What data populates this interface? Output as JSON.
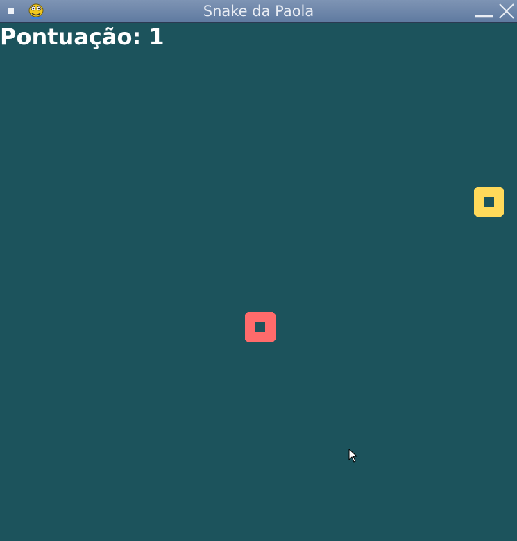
{
  "window": {
    "title": "Snake da Paola",
    "icons": {
      "menu": "window-menu-icon",
      "app": "pygame-snake-icon",
      "minimize": "minimize-icon",
      "close": "close-icon"
    }
  },
  "game": {
    "score_text": "Pontuação: 1",
    "colors": {
      "background": "#1c535c",
      "food": "#ffd95a",
      "snake": "#ff6b6b",
      "text": "#ffffff"
    }
  }
}
